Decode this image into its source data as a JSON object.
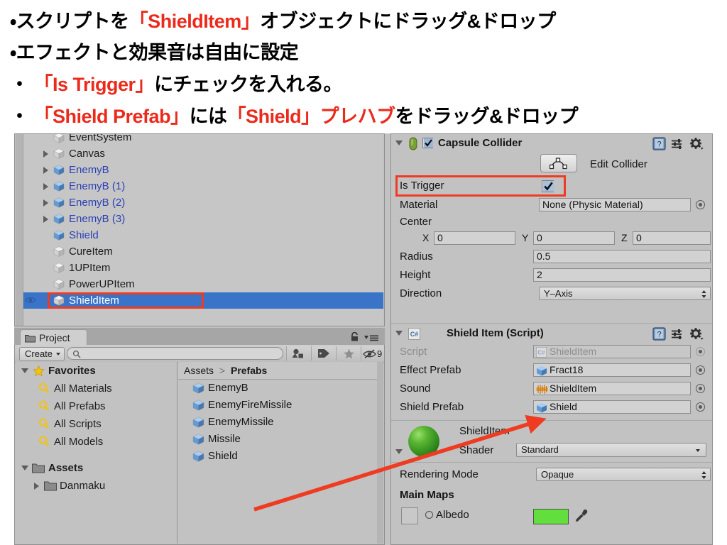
{
  "slide": {
    "bullets": [
      {
        "parts": [
          {
            "t": "・スクリプトを",
            "c": "black"
          },
          {
            "t": "「ShieldItem」",
            "c": "red"
          },
          {
            "t": "オブジェクトにドラッグ&ドロップ",
            "c": "black"
          }
        ]
      },
      {
        "parts": [
          {
            "t": "・エフェクトと効果音は自由に設定",
            "c": "black"
          }
        ]
      },
      {
        "parts": [
          {
            "t": "・ ",
            "c": "black"
          },
          {
            "t": "「Is Trigger」",
            "c": "red"
          },
          {
            "t": "にチェックを入れる。",
            "c": "black"
          }
        ]
      },
      {
        "parts": [
          {
            "t": "・ ",
            "c": "black"
          },
          {
            "t": "「Shield Prefab」",
            "c": "red"
          },
          {
            "t": "には",
            "c": "black"
          },
          {
            "t": "「Shield」",
            "c": "red"
          },
          {
            "t": "プレハブ",
            "c": "red"
          },
          {
            "t": "をドラッグ&ドロップ",
            "c": "black"
          }
        ]
      }
    ],
    "accent_red": "#ec2a1c"
  },
  "hierarchy": {
    "items": [
      {
        "label": "EventSystem",
        "indent": 56,
        "arrow": false,
        "icon": "gameobject-cube-white",
        "prefab": false,
        "selected": false,
        "chevron": false,
        "clipped": true
      },
      {
        "label": "Canvas",
        "indent": 56,
        "arrow": true,
        "icon": "gameobject-cube-white",
        "prefab": false,
        "selected": false,
        "chevron": false
      },
      {
        "label": "EnemyB",
        "indent": 56,
        "arrow": true,
        "icon": "prefab-cube-blue",
        "prefab": true,
        "selected": false,
        "chevron": true
      },
      {
        "label": "EnemyB (1)",
        "indent": 56,
        "arrow": true,
        "icon": "prefab-cube-blue",
        "prefab": true,
        "selected": false,
        "chevron": true
      },
      {
        "label": "EnemyB (2)",
        "indent": 56,
        "arrow": true,
        "icon": "prefab-cube-blue",
        "prefab": true,
        "selected": false,
        "chevron": true
      },
      {
        "label": "EnemyB (3)",
        "indent": 56,
        "arrow": true,
        "icon": "prefab-cube-blue",
        "prefab": true,
        "selected": false,
        "chevron": true
      },
      {
        "label": "Shield",
        "indent": 56,
        "arrow": false,
        "icon": "prefab-cube-blue",
        "prefab": true,
        "selected": false,
        "chevron": true
      },
      {
        "label": "CureItem",
        "indent": 56,
        "arrow": false,
        "icon": "gameobject-cube-white",
        "prefab": false,
        "selected": false,
        "chevron": false
      },
      {
        "label": "1UPItem",
        "indent": 56,
        "arrow": false,
        "icon": "gameobject-cube-white",
        "prefab": false,
        "selected": false,
        "chevron": false
      },
      {
        "label": "PowerUPItem",
        "indent": 56,
        "arrow": false,
        "icon": "gameobject-cube-white",
        "prefab": false,
        "selected": false,
        "chevron": false
      },
      {
        "label": "ShieldItem",
        "indent": 56,
        "arrow": false,
        "icon": "gameobject-cube-white",
        "prefab": false,
        "selected": true,
        "chevron": false,
        "eye": true,
        "highlighted": true
      }
    ],
    "selected_row_color": "#3a74c8",
    "prefab_label_color": "#2b3fb5"
  },
  "project": {
    "tab_label": "Project",
    "create_label": "Create",
    "search_value": "",
    "search_placeholder": "",
    "filter_count": "9",
    "favorites_header": "Favorites",
    "favorites": [
      "All Materials",
      "All Prefabs",
      "All Scripts",
      "All Models"
    ],
    "assets_header": "Assets",
    "assets_child": "Danmaku",
    "breadcrumb": {
      "root": "Assets",
      "sep": ">",
      "current": "Prefabs"
    },
    "asset_items": [
      "EnemyB",
      "EnemyFireMissile",
      "EnemyMissile",
      "Missile",
      "Shield"
    ]
  },
  "inspector": {
    "capsule_collider": {
      "title": "Capsule Collider",
      "enabled": true,
      "edit_collider_label": "Edit Collider",
      "is_trigger_label": "Is Trigger",
      "is_trigger_value": true,
      "material_label": "Material",
      "material_value": "None (Physic Material)",
      "center_label": "Center",
      "center": {
        "x_label": "X",
        "x": "0",
        "y_label": "Y",
        "y": "0",
        "z_label": "Z",
        "z": "0"
      },
      "radius_label": "Radius",
      "radius_value": "0.5",
      "height_label": "Height",
      "height_value": "2",
      "direction_label": "Direction",
      "direction_value": "Y–Axis"
    },
    "shield_item_script": {
      "title": "Shield Item (Script)",
      "script_label": "Script",
      "script_value": "ShieldItem",
      "effect_prefab_label": "Effect Prefab",
      "effect_prefab_value": "Fract18",
      "sound_label": "Sound",
      "sound_value": "ShieldItem",
      "shield_prefab_label": "Shield Prefab",
      "shield_prefab_value": "Shield"
    },
    "material": {
      "name": "ShieldItem",
      "shader_label": "Shader",
      "shader_value": "Standard",
      "rendering_mode_label": "Rendering Mode",
      "rendering_mode_value": "Opaque",
      "main_maps_label": "Main Maps",
      "albedo_label": "Albedo",
      "albedo_color": "#63df3d"
    }
  }
}
